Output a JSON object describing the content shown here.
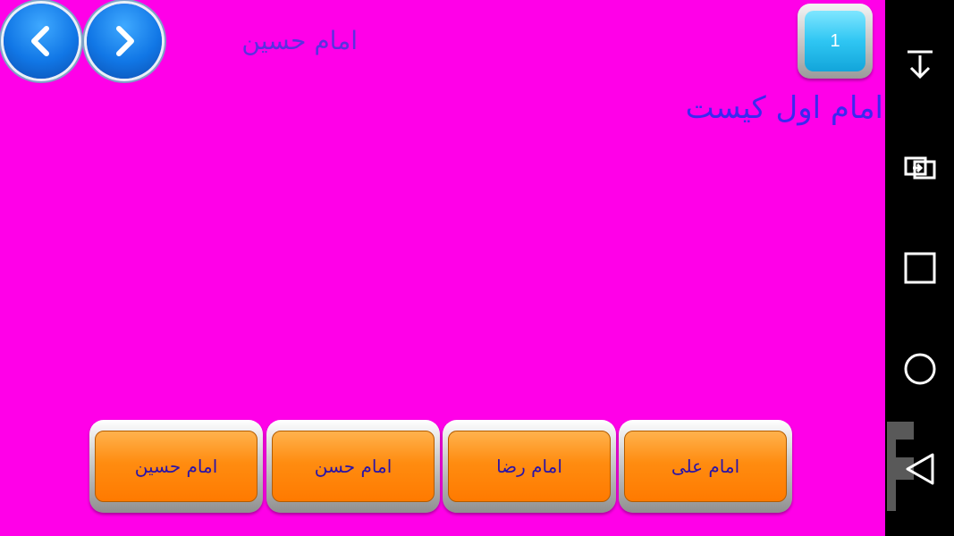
{
  "header": {
    "prev_icon": "chevron-left-icon",
    "next_icon": "chevron-right-icon",
    "selected_answer": "امام حسین",
    "question_number": "1"
  },
  "question": {
    "text": "امام اول کیست"
  },
  "answers": [
    {
      "label": "امام علی"
    },
    {
      "label": "امام رضا"
    },
    {
      "label": "امام حسن"
    },
    {
      "label": "امام حسین"
    }
  ],
  "nav_bar": {
    "icons": [
      "download-icon",
      "switch-icon",
      "recent-apps-icon",
      "home-icon",
      "back-icon"
    ]
  },
  "colors": {
    "background": "#ff00e8",
    "answer_button": "#ff8c10",
    "counter": "#2fc6f3",
    "question_text": "#3b28f0"
  }
}
